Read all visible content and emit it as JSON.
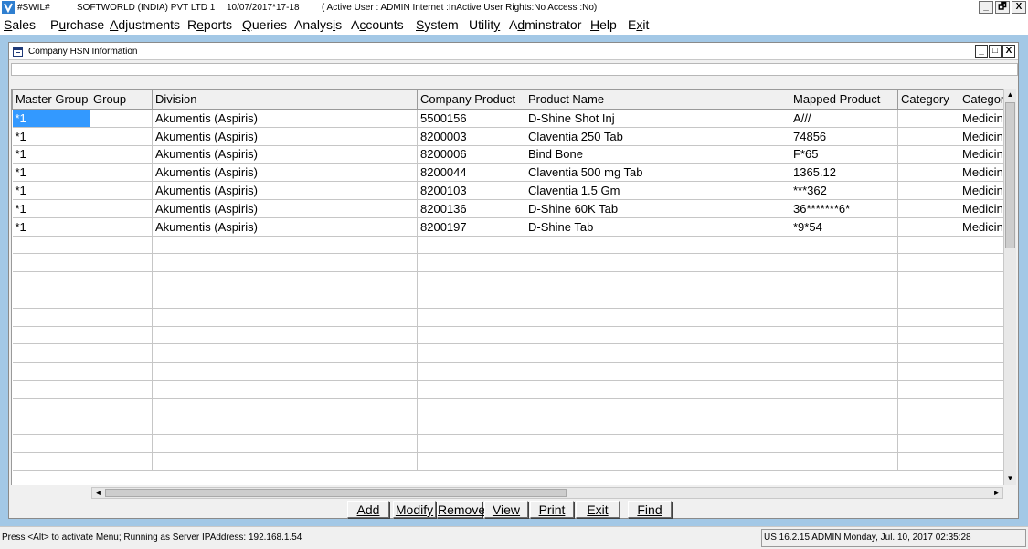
{
  "titlebar": {
    "app": "#SWIL#",
    "company": "SOFTWORLD (INDIA) PVT LTD 1",
    "date": "10/07/2017*17-18",
    "status": "( Active User : ADMIN Internet :InActive User Rights:No Access :No)",
    "min": "_",
    "restore": "🗗",
    "close": "X"
  },
  "menu": [
    {
      "pre": "",
      "ul": "S",
      "post": "ales"
    },
    {
      "pre": "P",
      "ul": "u",
      "post": "rchase"
    },
    {
      "pre": "",
      "ul": "A",
      "post": "djustments"
    },
    {
      "pre": "R",
      "ul": "e",
      "post": "ports"
    },
    {
      "pre": "",
      "ul": "Q",
      "post": "ueries"
    },
    {
      "pre": "Analys",
      "ul": "i",
      "post": "s"
    },
    {
      "pre": "A",
      "ul": "c",
      "post": "counts"
    },
    {
      "pre": "",
      "ul": "S",
      "post": "ystem"
    },
    {
      "pre": "Utilit",
      "ul": "y",
      "post": ""
    },
    {
      "pre": "A",
      "ul": "d",
      "post": "minstrator"
    },
    {
      "pre": "",
      "ul": "H",
      "post": "elp"
    },
    {
      "pre": "E",
      "ul": "x",
      "post": "it"
    }
  ],
  "child": {
    "title": "Company HSN Information",
    "min": "_",
    "max": "□",
    "close": "X"
  },
  "grid": {
    "columns": [
      "Master Group",
      "Group",
      "Division",
      "Company Product",
      "Product Name",
      "Mapped Product",
      "Category",
      "Category"
    ],
    "rows": [
      [
        "*1",
        "",
        "Akumentis (Aspiris)",
        "5500156",
        "D-Shine Shot Inj",
        "A///",
        "",
        "Medicine"
      ],
      [
        "*1",
        "",
        "Akumentis (Aspiris)",
        "8200003",
        "Claventia 250 Tab",
        "74856",
        "",
        "Medicine"
      ],
      [
        "*1",
        "",
        "Akumentis (Aspiris)",
        "8200006",
        "Bind Bone",
        "F*65",
        "",
        "Medicine"
      ],
      [
        "*1",
        "",
        "Akumentis (Aspiris)",
        "8200044",
        "Claventia 500 mg Tab",
        "1365.12",
        "",
        "Medicine"
      ],
      [
        "*1",
        "",
        "Akumentis (Aspiris)",
        "8200103",
        "Claventia 1.5 Gm",
        "***362",
        "",
        "Medicine"
      ],
      [
        "*1",
        "",
        "Akumentis (Aspiris)",
        "8200136",
        "D-Shine 60K Tab",
        "36*******6*",
        "",
        "Medicine"
      ],
      [
        "*1",
        "",
        "Akumentis (Aspiris)",
        "8200197",
        "D-Shine Tab",
        "*9*54",
        "",
        "Medicine"
      ]
    ],
    "empty_rows": 13
  },
  "scroll": {
    "up": "▲",
    "down": "▼",
    "left": "◄",
    "right": "►"
  },
  "buttons": [
    "Add",
    "Modify",
    "Remove",
    "View",
    "Print",
    "Exit",
    "Find"
  ],
  "status": {
    "left": "Press <Alt> to activate Menu; Running as Server IPAddress: 192.168.1.54",
    "right": "US 16.2.15 ADMIN  Monday, Jul. 10, 2017  02:35:28"
  }
}
